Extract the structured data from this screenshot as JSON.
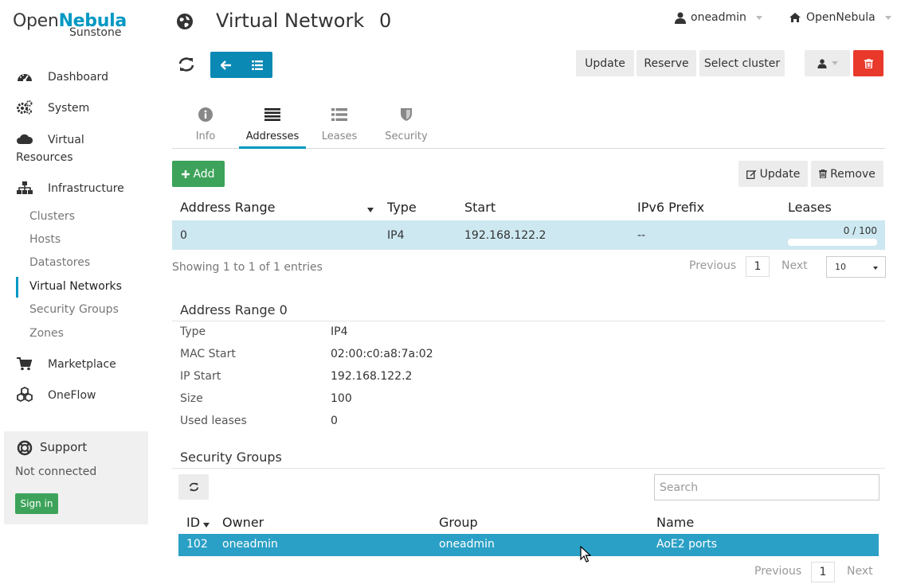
{
  "sidebar": {
    "logo": {
      "part1": "Open",
      "part2": "Nebula",
      "sub": "Sunstone"
    },
    "nav": [
      {
        "label": "Dashboard",
        "icon": "dashboard-icon"
      },
      {
        "label": "System",
        "icon": "cogs-icon"
      },
      {
        "label": "Virtual Resources",
        "icon": "cloud-icon"
      },
      {
        "label": "Infrastructure",
        "icon": "sitemap-icon"
      }
    ],
    "sub_items": [
      "Clusters",
      "Hosts",
      "Datastores",
      "Virtual Networks",
      "Security Groups",
      "Zones"
    ],
    "nav_after": [
      {
        "label": "Marketplace",
        "icon": "cart-icon"
      },
      {
        "label": "OneFlow",
        "icon": "cubes-icon"
      }
    ],
    "support": {
      "title": "Support",
      "status": "Not connected",
      "signin": "Sign in"
    }
  },
  "header": {
    "title": "Virtual Network",
    "id": "0",
    "user": "oneadmin",
    "zone": "OpenNebula"
  },
  "toolbar": {
    "update": "Update",
    "reserve": "Reserve",
    "select_cluster": "Select cluster"
  },
  "tabs": [
    {
      "label": "Info",
      "icon": "info-icon"
    },
    {
      "label": "Addresses",
      "icon": "list-icon",
      "active": true
    },
    {
      "label": "Leases",
      "icon": "list-alt-icon"
    },
    {
      "label": "Security",
      "icon": "shield-icon"
    }
  ],
  "addresses": {
    "add": "Add",
    "update": "Update",
    "remove": "Remove",
    "columns": [
      "Address Range",
      "Type",
      "Start",
      "IPv6 Prefix",
      "Leases"
    ],
    "rows": [
      {
        "id": "0",
        "type": "IP4",
        "start": "192.168.122.2",
        "ipv6": "--",
        "leases": "0 / 100",
        "leases_fraction": 0.0
      }
    ],
    "showing": "Showing 1 to 1 of 1 entries",
    "pagination": {
      "previous": "Previous",
      "page": "1",
      "next": "Next",
      "page_size": "10"
    }
  },
  "address_range": {
    "title": "Address Range 0",
    "fields": [
      {
        "key": "Type",
        "value": "IP4"
      },
      {
        "key": "MAC Start",
        "value": "02:00:c0:a8:7a:02"
      },
      {
        "key": "IP Start",
        "value": "192.168.122.2"
      },
      {
        "key": "Size",
        "value": "100"
      },
      {
        "key": "Used leases",
        "value": "0"
      }
    ]
  },
  "security_groups": {
    "title": "Security Groups",
    "search_placeholder": "Search",
    "columns": [
      "ID",
      "Owner",
      "Group",
      "Name"
    ],
    "rows": [
      {
        "id": "102",
        "owner": "oneadmin",
        "group": "oneadmin",
        "name": "AoE2 ports"
      }
    ],
    "pagination": {
      "previous": "Previous",
      "page": "1",
      "next": "Next"
    }
  },
  "colors": {
    "accent": "#0098c3",
    "primary_button": "#0a89b5",
    "success": "#3da35a",
    "danger": "#e8392b",
    "row_selected": "#cde8f1",
    "row_highlight": "#2ba0c6"
  }
}
